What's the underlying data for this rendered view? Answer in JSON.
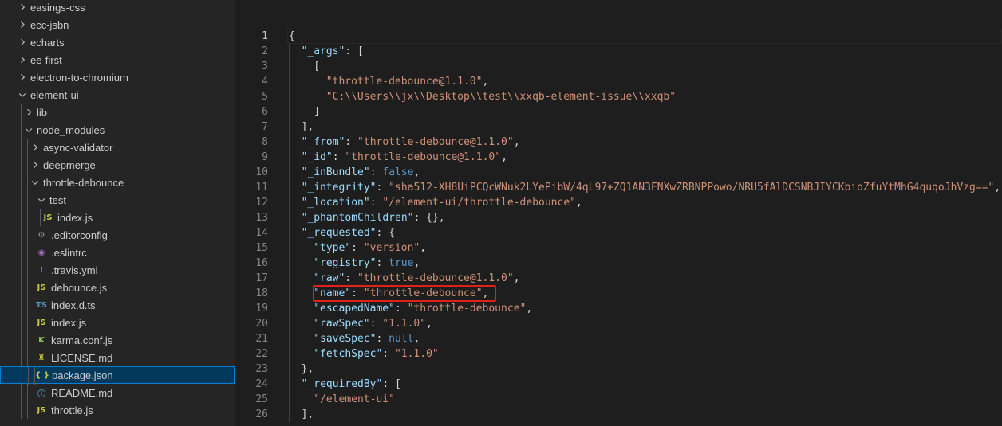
{
  "explorer": {
    "items": [
      {
        "label": "easings-css",
        "type": "folder",
        "expanded": false,
        "depth": 1
      },
      {
        "label": "ecc-jsbn",
        "type": "folder",
        "expanded": false,
        "depth": 1
      },
      {
        "label": "echarts",
        "type": "folder",
        "expanded": false,
        "depth": 1
      },
      {
        "label": "ee-first",
        "type": "folder",
        "expanded": false,
        "depth": 1
      },
      {
        "label": "electron-to-chromium",
        "type": "folder",
        "expanded": false,
        "depth": 1
      },
      {
        "label": "element-ui",
        "type": "folder",
        "expanded": true,
        "depth": 1
      },
      {
        "label": "lib",
        "type": "folder",
        "expanded": false,
        "depth": 2
      },
      {
        "label": "node_modules",
        "type": "folder",
        "expanded": true,
        "depth": 2
      },
      {
        "label": "async-validator",
        "type": "folder",
        "expanded": false,
        "depth": 3
      },
      {
        "label": "deepmerge",
        "type": "folder",
        "expanded": false,
        "depth": 3
      },
      {
        "label": "throttle-debounce",
        "type": "folder",
        "expanded": true,
        "depth": 3
      },
      {
        "label": "test",
        "type": "folder",
        "expanded": true,
        "depth": 4
      },
      {
        "label": "index.js",
        "type": "js",
        "depth": 5
      },
      {
        "label": ".editorconfig",
        "type": "gear",
        "depth": 4
      },
      {
        "label": ".eslintrc",
        "type": "eslint",
        "depth": 4
      },
      {
        "label": ".travis.yml",
        "type": "yml",
        "depth": 4
      },
      {
        "label": "debounce.js",
        "type": "js",
        "depth": 4
      },
      {
        "label": "index.d.ts",
        "type": "ts",
        "depth": 4
      },
      {
        "label": "index.js",
        "type": "js",
        "depth": 4
      },
      {
        "label": "karma.conf.js",
        "type": "karma",
        "depth": 4
      },
      {
        "label": "LICENSE.md",
        "type": "license",
        "depth": 4
      },
      {
        "label": "package.json",
        "type": "json",
        "depth": 4,
        "selected": true
      },
      {
        "label": "README.md",
        "type": "info",
        "depth": 4
      },
      {
        "label": "throttle.js",
        "type": "js",
        "depth": 4
      }
    ]
  },
  "icons": {
    "js": {
      "glyph": "JS",
      "color": "#cbcb41"
    },
    "ts": {
      "glyph": "TS",
      "color": "#519aba"
    },
    "json": {
      "glyph": "{ }",
      "color": "#cbcb41"
    },
    "gear": {
      "glyph": "⚙",
      "color": "#9e9e9e"
    },
    "eslint": {
      "glyph": "◉",
      "color": "#a074c4"
    },
    "yml": {
      "glyph": "!",
      "color": "#a074c4"
    },
    "karma": {
      "glyph": "K",
      "color": "#8dc149"
    },
    "license": {
      "glyph": "♜",
      "color": "#cbcb41"
    },
    "info": {
      "glyph": "ⓘ",
      "color": "#519aba"
    }
  },
  "editor": {
    "active_line": 1,
    "highlighted_line": 18,
    "lines": [
      {
        "n": "1",
        "indent": 0,
        "tokens": [
          [
            "p",
            "{"
          ]
        ]
      },
      {
        "n": "2",
        "indent": 1,
        "tokens": [
          [
            "k",
            "\"_args\""
          ],
          [
            "p",
            ": ["
          ]
        ]
      },
      {
        "n": "3",
        "indent": 2,
        "tokens": [
          [
            "p",
            "["
          ]
        ]
      },
      {
        "n": "4",
        "indent": 3,
        "tokens": [
          [
            "s",
            "\"throttle-debounce@1.1.0\""
          ],
          [
            "p",
            ","
          ]
        ]
      },
      {
        "n": "5",
        "indent": 3,
        "tokens": [
          [
            "s",
            "\"C:\\\\Users\\\\jx\\\\Desktop\\\\test\\\\xxqb-element-issue\\\\xxqb\""
          ]
        ]
      },
      {
        "n": "6",
        "indent": 2,
        "tokens": [
          [
            "p",
            "]"
          ]
        ]
      },
      {
        "n": "7",
        "indent": 1,
        "tokens": [
          [
            "p",
            "],"
          ]
        ]
      },
      {
        "n": "8",
        "indent": 1,
        "tokens": [
          [
            "k",
            "\"_from\""
          ],
          [
            "p",
            ": "
          ],
          [
            "s",
            "\"throttle-debounce@1.1.0\""
          ],
          [
            "p",
            ","
          ]
        ]
      },
      {
        "n": "9",
        "indent": 1,
        "tokens": [
          [
            "k",
            "\"_id\""
          ],
          [
            "p",
            ": "
          ],
          [
            "s",
            "\"throttle-debounce@1.1.0\""
          ],
          [
            "p",
            ","
          ]
        ]
      },
      {
        "n": "10",
        "indent": 1,
        "tokens": [
          [
            "k",
            "\"_inBundle\""
          ],
          [
            "p",
            ": "
          ],
          [
            "b",
            "false"
          ],
          [
            "p",
            ","
          ]
        ]
      },
      {
        "n": "11",
        "indent": 1,
        "tokens": [
          [
            "k",
            "\"_integrity\""
          ],
          [
            "p",
            ": "
          ],
          [
            "s",
            "\"sha512-XH8UiPCQcWNuk2LYePibW/4qL97+ZQ1AN3FNXwZRBNPPowo/NRU5fAlDCSNBJIYCKbioZfuYtMhG4quqoJhVzg==\""
          ],
          [
            "p",
            ","
          ]
        ]
      },
      {
        "n": "12",
        "indent": 1,
        "tokens": [
          [
            "k",
            "\"_location\""
          ],
          [
            "p",
            ": "
          ],
          [
            "s",
            "\"/element-ui/throttle-debounce\""
          ],
          [
            "p",
            ","
          ]
        ]
      },
      {
        "n": "13",
        "indent": 1,
        "tokens": [
          [
            "k",
            "\"_phantomChildren\""
          ],
          [
            "p",
            ": {},"
          ]
        ]
      },
      {
        "n": "14",
        "indent": 1,
        "tokens": [
          [
            "k",
            "\"_requested\""
          ],
          [
            "p",
            ": {"
          ]
        ]
      },
      {
        "n": "15",
        "indent": 2,
        "tokens": [
          [
            "k",
            "\"type\""
          ],
          [
            "p",
            ": "
          ],
          [
            "s",
            "\"version\""
          ],
          [
            "p",
            ","
          ]
        ]
      },
      {
        "n": "16",
        "indent": 2,
        "tokens": [
          [
            "k",
            "\"registry\""
          ],
          [
            "p",
            ": "
          ],
          [
            "b",
            "true"
          ],
          [
            "p",
            ","
          ]
        ]
      },
      {
        "n": "17",
        "indent": 2,
        "tokens": [
          [
            "k",
            "\"raw\""
          ],
          [
            "p",
            ": "
          ],
          [
            "s",
            "\"throttle-debounce@1.1.0\""
          ],
          [
            "p",
            ","
          ]
        ]
      },
      {
        "n": "18",
        "indent": 2,
        "tokens": [
          [
            "k",
            "\"name\""
          ],
          [
            "p",
            ": "
          ],
          [
            "s",
            "\"throttle-debounce\""
          ],
          [
            "p",
            ","
          ]
        ]
      },
      {
        "n": "19",
        "indent": 2,
        "tokens": [
          [
            "k",
            "\"escapedName\""
          ],
          [
            "p",
            ": "
          ],
          [
            "s",
            "\"throttle-debounce\""
          ],
          [
            "p",
            ","
          ]
        ]
      },
      {
        "n": "20",
        "indent": 2,
        "tokens": [
          [
            "k",
            "\"rawSpec\""
          ],
          [
            "p",
            ": "
          ],
          [
            "s",
            "\"1.1.0\""
          ],
          [
            "p",
            ","
          ]
        ]
      },
      {
        "n": "21",
        "indent": 2,
        "tokens": [
          [
            "k",
            "\"saveSpec\""
          ],
          [
            "p",
            ": "
          ],
          [
            "b",
            "null"
          ],
          [
            "p",
            ","
          ]
        ]
      },
      {
        "n": "22",
        "indent": 2,
        "tokens": [
          [
            "k",
            "\"fetchSpec\""
          ],
          [
            "p",
            ": "
          ],
          [
            "s",
            "\"1.1.0\""
          ]
        ]
      },
      {
        "n": "23",
        "indent": 1,
        "tokens": [
          [
            "p",
            "},"
          ]
        ]
      },
      {
        "n": "24",
        "indent": 1,
        "tokens": [
          [
            "k",
            "\"_requiredBy\""
          ],
          [
            "p",
            ": ["
          ]
        ]
      },
      {
        "n": "25",
        "indent": 2,
        "tokens": [
          [
            "s",
            "\"/element-ui\""
          ]
        ]
      },
      {
        "n": "26",
        "indent": 1,
        "tokens": [
          [
            "p",
            "],"
          ]
        ]
      }
    ]
  },
  "colors": {
    "editor_bg": "#1e1e1e",
    "sidebar_bg": "#252526",
    "selection_bg": "#04395e",
    "highlight_box": "#e0201b"
  }
}
